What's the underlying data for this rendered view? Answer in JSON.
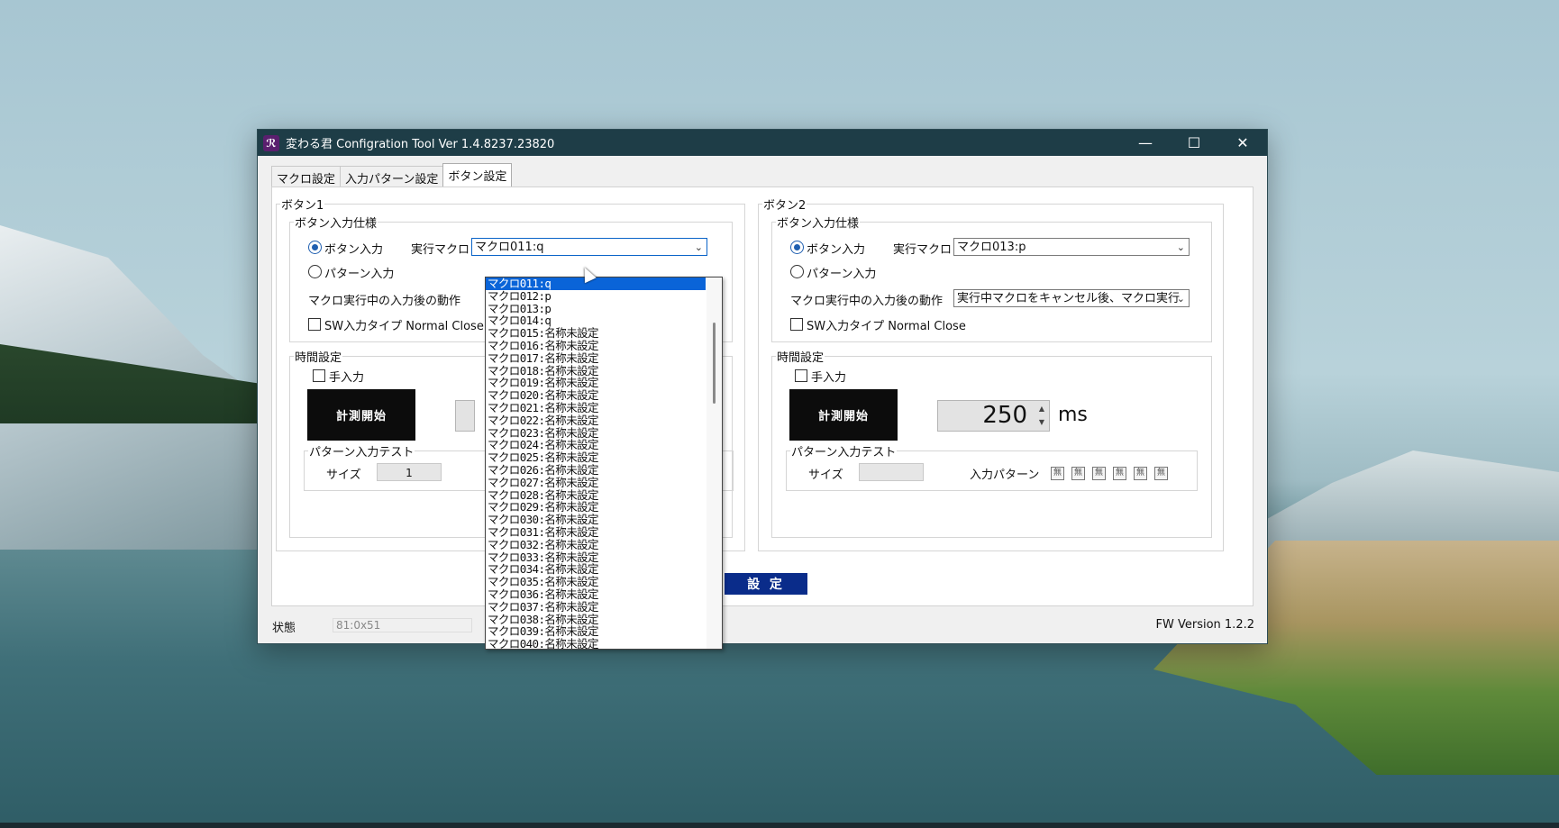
{
  "window": {
    "title": "変わる君 Configration Tool Ver 1.4.8237.23820",
    "controls": {
      "minimize": "—",
      "maximize": "☐",
      "close": "✕"
    }
  },
  "tabs": [
    "マクロ設定",
    "入力パターン設定",
    "ボタン設定"
  ],
  "active_tab": "ボタン設定",
  "button1": {
    "title": "ボタン1",
    "spec_title": "ボタン入力仕様",
    "radio_button_input": "ボタン入力",
    "radio_pattern_input": "パターン入力",
    "exec_macro_label": "実行マクロ",
    "exec_macro_value": "マクロ011:q",
    "during_exec_label": "マクロ実行中の入力後の動作",
    "sw_type_label": "SW入力タイプ Normal Close",
    "time_title": "時間設定",
    "manual_label": "手入力",
    "measure_btn": "計測開始",
    "test_title": "パターン入力テスト",
    "size_label": "サイズ",
    "size_value": "1"
  },
  "button2": {
    "title": "ボタン2",
    "spec_title": "ボタン入力仕様",
    "radio_button_input": "ボタン入力",
    "radio_pattern_input": "パターン入力",
    "exec_macro_label": "実行マクロ",
    "exec_macro_value": "マクロ013:p",
    "during_exec_label": "マクロ実行中の入力後の動作",
    "during_exec_value": "実行中マクロをキャンセル後、マクロ実行",
    "sw_type_label": "SW入力タイプ Normal Close",
    "time_title": "時間設定",
    "manual_label": "手入力",
    "measure_btn": "計測開始",
    "time_value": "250",
    "time_unit": "ms",
    "test_title": "パターン入力テスト",
    "size_label": "サイズ",
    "size_value": "",
    "pattern_label": "入力パターン",
    "pattern_box": "無"
  },
  "set_button": "設 定",
  "status": {
    "label": "状態",
    "value": "81:0x51"
  },
  "fw_version": "FW Version 1.2.2",
  "dropdown_items": [
    "マクロ011:q",
    "マクロ012:p",
    "マクロ013:p",
    "マクロ014:q",
    "マクロ015:名称未設定",
    "マクロ016:名称未設定",
    "マクロ017:名称未設定",
    "マクロ018:名称未設定",
    "マクロ019:名称未設定",
    "マクロ020:名称未設定",
    "マクロ021:名称未設定",
    "マクロ022:名称未設定",
    "マクロ023:名称未設定",
    "マクロ024:名称未設定",
    "マクロ025:名称未設定",
    "マクロ026:名称未設定",
    "マクロ027:名称未設定",
    "マクロ028:名称未設定",
    "マクロ029:名称未設定",
    "マクロ030:名称未設定",
    "マクロ031:名称未設定",
    "マクロ032:名称未設定",
    "マクロ033:名称未設定",
    "マクロ034:名称未設定",
    "マクロ035:名称未設定",
    "マクロ036:名称未設定",
    "マクロ037:名称未設定",
    "マクロ038:名称未設定",
    "マクロ039:名称未設定",
    "マクロ040:名称未設定"
  ],
  "dropdown_selected_index": 0
}
